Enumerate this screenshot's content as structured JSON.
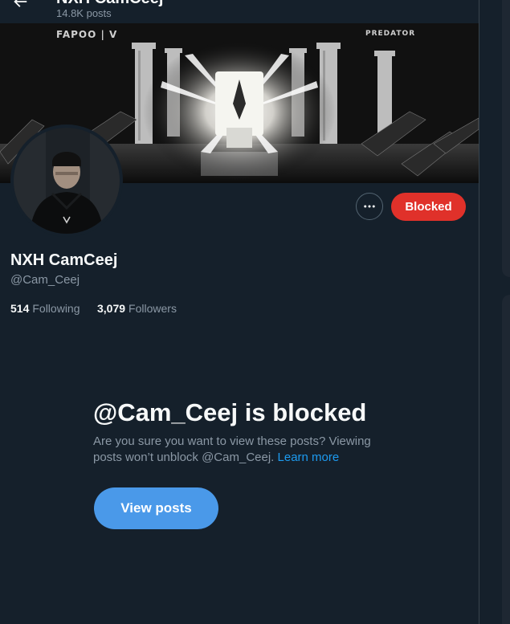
{
  "header": {
    "title": "NXH CamCeej",
    "post_count": "14.8K posts"
  },
  "banner": {
    "brand_left": "FAPOO | V",
    "brand_right": "PREDATOR"
  },
  "actions": {
    "more_icon": "more-dots-icon",
    "blocked_label": "Blocked"
  },
  "profile": {
    "display_name": "NXH CamCeej",
    "handle": "@Cam_Ceej",
    "following_count": "514",
    "following_label": "Following",
    "followers_count": "3,079",
    "followers_label": "Followers"
  },
  "blocked_notice": {
    "title": "@Cam_Ceej is blocked",
    "description": "Are you sure you want to view these posts? Viewing posts won’t unblock @Cam_Ceej.",
    "learn_more": "Learn more",
    "view_posts_label": "View posts"
  },
  "colors": {
    "background": "#15202b",
    "accent": "#1d9bf0",
    "blocked_red": "#e0312a",
    "view_posts_blue": "#4a99e9",
    "muted_text": "#8b98a5"
  }
}
